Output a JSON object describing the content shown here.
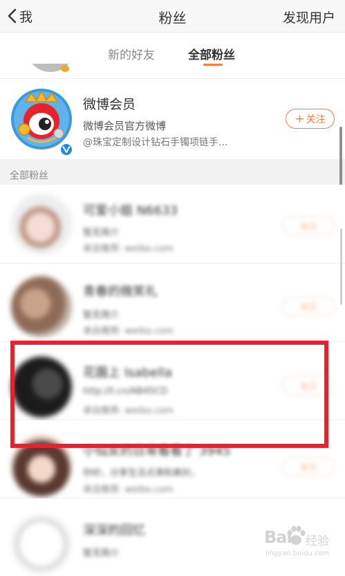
{
  "nav": {
    "back_label": "我",
    "title": "粉丝",
    "right_action": "发现用户"
  },
  "tabs": [
    {
      "label": "新的好友",
      "active": false
    },
    {
      "label": "全部粉丝",
      "active": true
    }
  ],
  "member_card": {
    "name": "微博会员",
    "description": "微博会员官方微博",
    "recommend_reason": "@珠宝定制设计钻石手镯项链手...",
    "follow_label": "关注",
    "verified": true
  },
  "section_header": "全部粉丝",
  "followers": [
    {
      "name": "可爱小姐 N6633",
      "line2": "暂无简介",
      "line3": "来自推荐: weibo.com",
      "follow_label": "关注"
    },
    {
      "name": "青春的微笑礼",
      "line2": "暂无简介",
      "line3": "来自推荐: weibo.com",
      "follow_label": "关注"
    },
    {
      "name": "花園上 Isabella",
      "line2": "http://t.cn/AB45CD",
      "line3": "来自推荐: weibo.com",
      "follow_label": "关注"
    },
    {
      "name": "小仙女的日常看看了 3945",
      "line2": "你好，分享生活点滴和美好。",
      "line3": "来自推荐: weibo.com",
      "follow_label": "关注"
    },
    {
      "name": "深深的回忆",
      "line2": "暂无简介",
      "line3": "来自推荐: weibo.com",
      "follow_label": "关注"
    }
  ],
  "watermark": {
    "logo": "Bai",
    "text": "经验",
    "url": "jingyan.baidu.com"
  },
  "colors": {
    "accent": "#fa7d3c",
    "highlight": "#e8212c",
    "verified": "#1e88e5"
  }
}
